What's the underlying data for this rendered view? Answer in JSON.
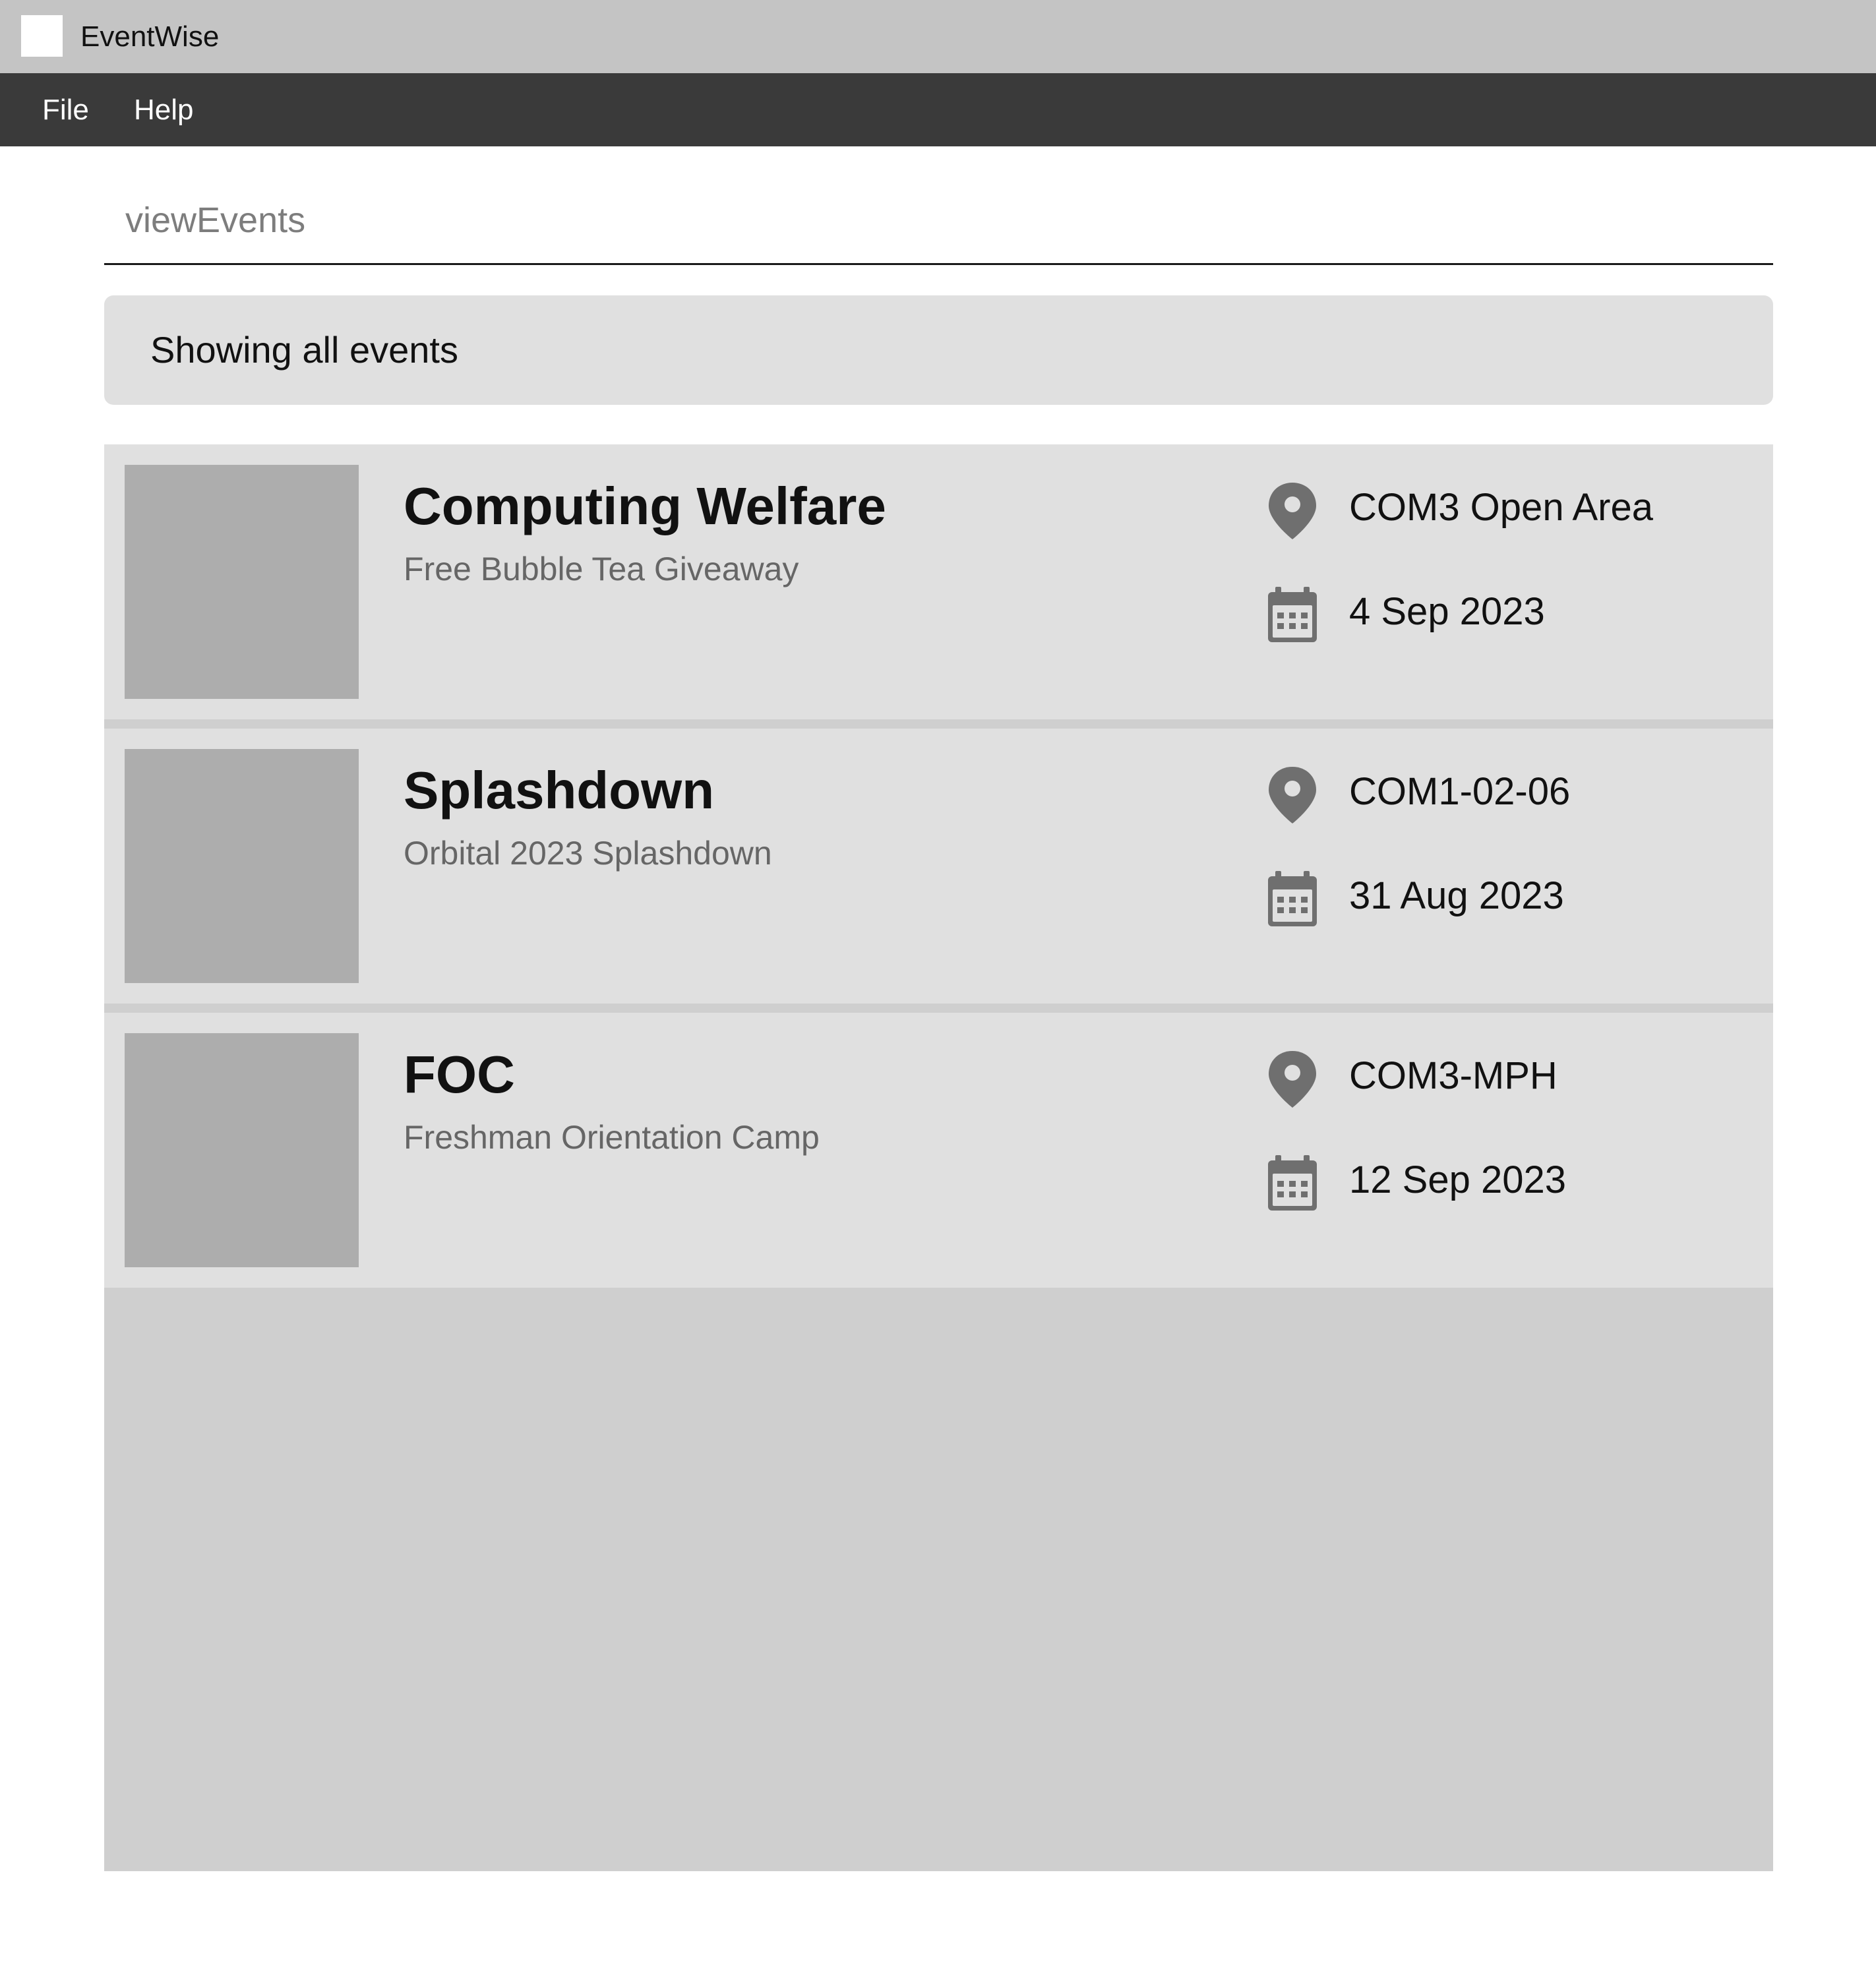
{
  "window": {
    "title": "EventWise"
  },
  "menu": {
    "file_label": "File",
    "help_label": "Help"
  },
  "command": {
    "placeholder": "viewEvents",
    "value": ""
  },
  "result": {
    "message": "Showing all events"
  },
  "events": [
    {
      "name": "Computing Welfare",
      "description": "Free Bubble Tea Giveaway",
      "location": "COM3 Open Area",
      "date": "4 Sep 2023"
    },
    {
      "name": "Splashdown",
      "description": "Orbital 2023 Splashdown",
      "location": "COM1-02-06",
      "date": "31 Aug 2023"
    },
    {
      "name": "FOC",
      "description": "Freshman Orientation Camp",
      "location": "COM3-MPH",
      "date": "12 Sep 2023"
    }
  ],
  "icons": {
    "location": "map-pin-icon",
    "date": "calendar-icon",
    "app": "app-icon"
  },
  "colors": {
    "titlebar": "#c4c4c4",
    "menubar": "#3a3a3a",
    "card": "#e0e0e0",
    "list_background": "#cfcfcf",
    "thumbnail": "#adadad",
    "icon": "#6f6f6f"
  }
}
